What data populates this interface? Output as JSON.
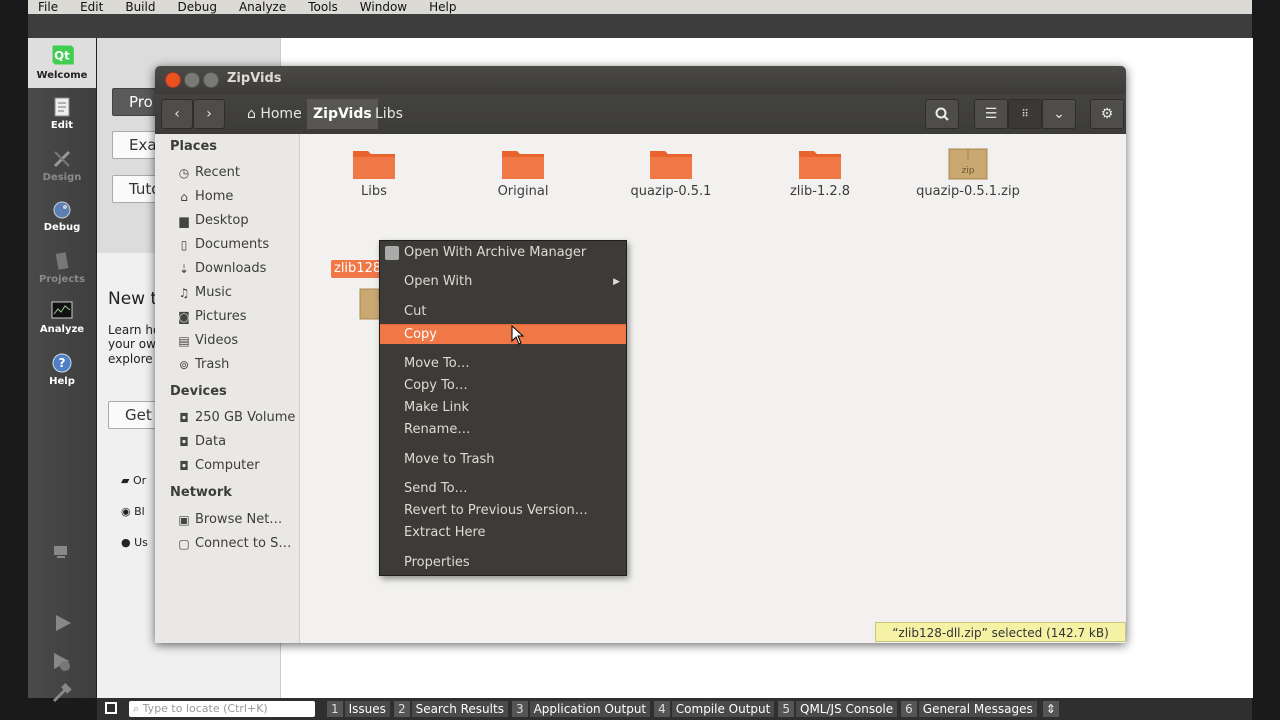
{
  "menubar": {
    "items": [
      "File",
      "Edit",
      "Build",
      "Debug",
      "Analyze",
      "Tools",
      "Window",
      "Help"
    ]
  },
  "modes": [
    {
      "label": "Welcome",
      "icon": "qt-logo-icon",
      "dim": false
    },
    {
      "label": "Edit",
      "icon": "document-icon",
      "dim": false
    },
    {
      "label": "Design",
      "icon": "pencil-icon",
      "dim": true
    },
    {
      "label": "Debug",
      "icon": "bug-icon",
      "dim": false
    },
    {
      "label": "Projects",
      "icon": "wrench-icon",
      "dim": true
    },
    {
      "label": "Analyze",
      "icon": "monitor-icon",
      "dim": false
    },
    {
      "label": "Help",
      "icon": "help-icon",
      "dim": false
    }
  ],
  "welcome": {
    "btn_projects": "Pro",
    "btn_examples": "Exa",
    "btn_tutorials": "Tuto",
    "new_heading": "New t",
    "learn_lines": [
      "Learn ho",
      "your ow",
      "explore"
    ],
    "get_btn": "Get",
    "links": [
      "Or",
      "Bl",
      "Us"
    ]
  },
  "window": {
    "title": "ZipVids",
    "breadcrumbs": [
      "Home",
      "ZipVids",
      "Libs"
    ],
    "search_icon": "search-icon",
    "settings_icon": "gear-icon"
  },
  "sidebar": {
    "places_header": "Places",
    "places": [
      {
        "label": "Recent",
        "icon": "clock-icon",
        "glyph": "◷"
      },
      {
        "label": "Home",
        "icon": "home-icon",
        "glyph": "⌂"
      },
      {
        "label": "Desktop",
        "icon": "desktop-icon",
        "glyph": "▆"
      },
      {
        "label": "Documents",
        "icon": "document-icon",
        "glyph": "▯"
      },
      {
        "label": "Downloads",
        "icon": "download-icon",
        "glyph": "⇣"
      },
      {
        "label": "Music",
        "icon": "music-icon",
        "glyph": "♫"
      },
      {
        "label": "Pictures",
        "icon": "camera-icon",
        "glyph": "◙"
      },
      {
        "label": "Videos",
        "icon": "film-icon",
        "glyph": "▤"
      },
      {
        "label": "Trash",
        "icon": "trash-icon",
        "glyph": "⊚"
      }
    ],
    "devices_header": "Devices",
    "devices": [
      {
        "label": "250 GB Volume",
        "icon": "drive-icon",
        "glyph": "◘"
      },
      {
        "label": "Data",
        "icon": "drive-icon",
        "glyph": "◘"
      },
      {
        "label": "Computer",
        "icon": "drive-icon",
        "glyph": "◘"
      }
    ],
    "network_header": "Network",
    "network": [
      {
        "label": "Browse Net…",
        "icon": "network-icon",
        "glyph": "▣"
      },
      {
        "label": "Connect to S…",
        "icon": "server-icon",
        "glyph": "▢"
      }
    ]
  },
  "files": [
    {
      "label": "Libs",
      "type": "folder"
    },
    {
      "label": "Original",
      "type": "folder"
    },
    {
      "label": "quazip-0.5.1",
      "type": "folder"
    },
    {
      "label": "zlib-1.2.8",
      "type": "folder"
    },
    {
      "label": "quazip-0.5.1.zip",
      "type": "zip"
    }
  ],
  "selected_file_label": "zlib128",
  "zip_badge": "zip",
  "context_menu": [
    {
      "label": "Open With Archive Manager",
      "highlight": false
    },
    {
      "label": "Open With",
      "highlight": false,
      "submenu": true
    },
    {
      "label": "Cut",
      "highlight": false
    },
    {
      "label": "Copy",
      "highlight": true
    },
    {
      "label": "Move To…",
      "highlight": false
    },
    {
      "label": "Copy To…",
      "highlight": false
    },
    {
      "label": "Make Link",
      "highlight": false
    },
    {
      "label": "Rename…",
      "highlight": false
    },
    {
      "label": "Move to Trash",
      "highlight": false
    },
    {
      "label": "Send To…",
      "highlight": false
    },
    {
      "label": "Revert to Previous Version…",
      "highlight": false
    },
    {
      "label": "Extract Here",
      "highlight": false
    },
    {
      "label": "Properties",
      "highlight": false
    }
  ],
  "status_text": "“zlib128-dll.zip” selected  (142.7 kB)",
  "bottombar": {
    "locate_placeholder": "Type to locate (Ctrl+K)",
    "panes": [
      {
        "num": "1",
        "label": "Issues"
      },
      {
        "num": "2",
        "label": "Search Results"
      },
      {
        "num": "3",
        "label": "Application Output"
      },
      {
        "num": "4",
        "label": "Compile Output"
      },
      {
        "num": "5",
        "label": "QML/JS Console"
      },
      {
        "num": "6",
        "label": "General Messages"
      }
    ]
  },
  "colors": {
    "accent": "#f07746",
    "titlebar": "#3c3b37",
    "folder": "#e8642c"
  }
}
